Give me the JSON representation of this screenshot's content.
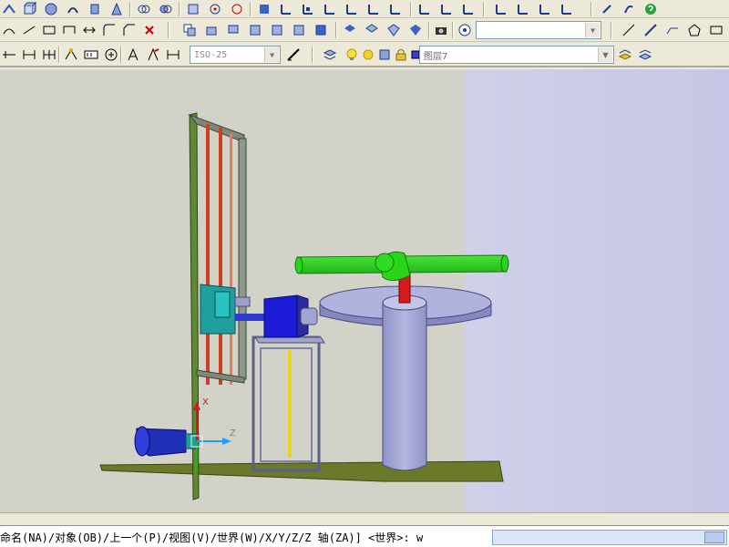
{
  "toolbar": {
    "dimstyle": {
      "value": "ISO-25"
    },
    "layer": {
      "name": "图层7"
    },
    "view_combo": {
      "value": ""
    }
  },
  "command_line": {
    "text": "命名(NA)/对象(OB)/上一个(P)/视图(V)/世界(W)/X/Y/Z/Z 轴(ZA)] <世界>: w"
  },
  "ucs_icon": {
    "x_label": "X",
    "z_label": "Z"
  },
  "colors": {
    "viewport_left": "#d3d2c8",
    "viewport_right": "#c8c8e9",
    "tower_frame": "#7c8a7a",
    "rail_red": "#d04020",
    "crossarm": "#29d419",
    "column": "#a9acd8",
    "motor_blue": "#1b1bd8",
    "bracket_teal": "#1f9f9f",
    "base_plate": "#6b7a2a",
    "stand_yellow": "#e6d81a"
  }
}
